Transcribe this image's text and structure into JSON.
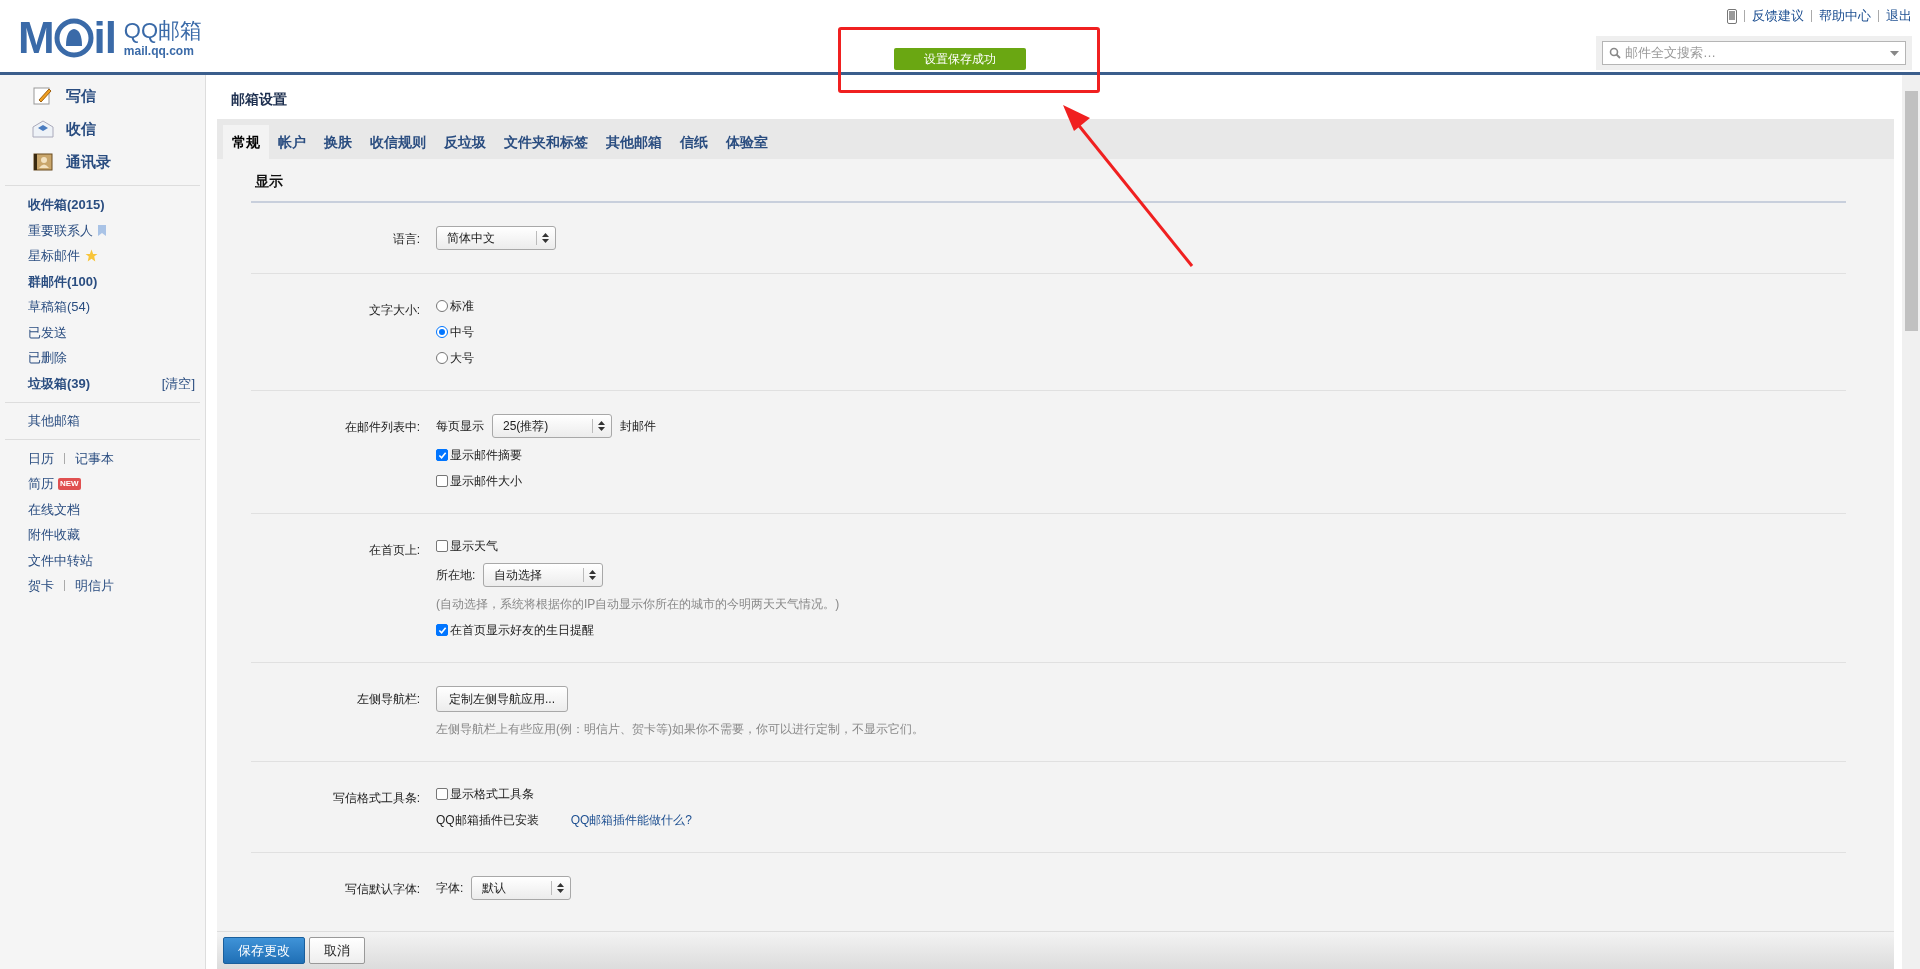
{
  "header": {
    "logo": {
      "wordmark_start": "M",
      "wordmark_end": "il",
      "name": "QQ邮箱",
      "domain": "mail.qq.com"
    },
    "top_links": [
      "反馈建议",
      "帮助中心",
      "退出"
    ],
    "search": {
      "placeholder": "邮件全文搜索…"
    },
    "toast": "设置保存成功"
  },
  "sidebar": {
    "actions": [
      {
        "kind": "compose",
        "label": "写信"
      },
      {
        "kind": "inbox",
        "label": "收信"
      },
      {
        "kind": "contacts",
        "label": "通讯录"
      }
    ],
    "folders": [
      {
        "label": "收件箱(2015)",
        "bold": true,
        "kind": "plain"
      },
      {
        "label": "重要联系人",
        "bold": false,
        "kind": "bookmark"
      },
      {
        "label": "星标邮件",
        "bold": false,
        "kind": "star"
      },
      {
        "label": "群邮件(100)",
        "bold": true,
        "kind": "plain"
      },
      {
        "label": "草稿箱(54)",
        "bold": false,
        "kind": "plain"
      },
      {
        "label": "已发送",
        "bold": false,
        "kind": "plain"
      },
      {
        "label": "已删除",
        "bold": false,
        "kind": "plain"
      },
      {
        "label": "垃圾箱(39)",
        "bold": true,
        "kind": "plain",
        "action": "[清空]"
      }
    ],
    "other_mailboxes": "其他邮箱",
    "apps": [
      {
        "links": [
          "日历",
          "记事本"
        ]
      },
      {
        "links": [
          "简历"
        ],
        "badge": "NEW"
      },
      {
        "links": [
          "在线文档"
        ]
      },
      {
        "links": [
          "附件收藏"
        ]
      },
      {
        "links": [
          "文件中转站"
        ]
      },
      {
        "links": [
          "贺卡",
          "明信片"
        ]
      }
    ]
  },
  "settings": {
    "title": "邮箱设置",
    "tabs": [
      {
        "label": "常规",
        "selected": true
      },
      {
        "label": "帐户",
        "selected": false
      },
      {
        "label": "换肤",
        "selected": false
      },
      {
        "label": "收信规则",
        "selected": false
      },
      {
        "label": "反垃圾",
        "selected": false
      },
      {
        "label": "文件夹和标签",
        "selected": false
      },
      {
        "label": "其他邮箱",
        "selected": false
      },
      {
        "label": "信纸",
        "selected": false
      },
      {
        "label": "体验室",
        "selected": false
      }
    ],
    "section": "显示",
    "rows": [
      {
        "label": "语言:",
        "lines": [
          [
            {
              "kind": "select",
              "value": "简体中文"
            }
          ]
        ]
      },
      {
        "label": "文字大小:",
        "lines": [
          [
            {
              "kind": "radio",
              "label": "标准",
              "selected": false
            }
          ],
          [
            {
              "kind": "radio",
              "label": "中号",
              "selected": true
            }
          ],
          [
            {
              "kind": "radio",
              "label": "大号",
              "selected": false
            }
          ]
        ]
      },
      {
        "label": "在邮件列表中:",
        "lines": [
          [
            {
              "kind": "text",
              "text": "每页显示"
            },
            {
              "kind": "select",
              "value": "25(推荐)"
            },
            {
              "kind": "text",
              "text": "封邮件"
            }
          ],
          [
            {
              "kind": "checkbox",
              "label": "显示邮件摘要",
              "checked": true
            }
          ],
          [
            {
              "kind": "checkbox",
              "label": "显示邮件大小",
              "checked": false
            }
          ]
        ]
      },
      {
        "label": "在首页上:",
        "lines": [
          [
            {
              "kind": "checkbox",
              "label": "显示天气",
              "checked": false
            }
          ],
          [
            {
              "kind": "text",
              "text": "所在地:"
            },
            {
              "kind": "select",
              "value": "自动选择"
            }
          ],
          [
            {
              "kind": "hint",
              "text": "(自动选择，系统将根据你的IP自动显示你所在的城市的今明两天天气情况。)"
            }
          ],
          [
            {
              "kind": "checkbox",
              "label": "在首页显示好友的生日提醒",
              "checked": true
            }
          ]
        ]
      },
      {
        "label": "左侧导航栏:",
        "lines": [
          [
            {
              "kind": "button",
              "label": "定制左侧导航应用..."
            }
          ],
          [
            {
              "kind": "hint",
              "text": "左侧导航栏上有些应用(例：明信片、贺卡等)如果你不需要，你可以进行定制，不显示它们。"
            }
          ]
        ]
      },
      {
        "label": "写信格式工具条:",
        "lines": [
          [
            {
              "kind": "checkbox",
              "label": "显示格式工具条",
              "checked": false
            }
          ],
          [
            {
              "kind": "text",
              "text": "QQ邮箱插件已安装"
            },
            {
              "kind": "link",
              "text": "QQ邮箱插件能做什么?"
            }
          ]
        ]
      },
      {
        "label": "写信默认字体:",
        "lines": [
          [
            {
              "kind": "text",
              "text": "字体:"
            },
            {
              "kind": "select",
              "value": "默认"
            }
          ]
        ]
      }
    ],
    "footer_buttons": [
      {
        "kind": "primary",
        "label": "保存更改"
      },
      {
        "kind": "secondary",
        "label": "取消"
      }
    ]
  }
}
